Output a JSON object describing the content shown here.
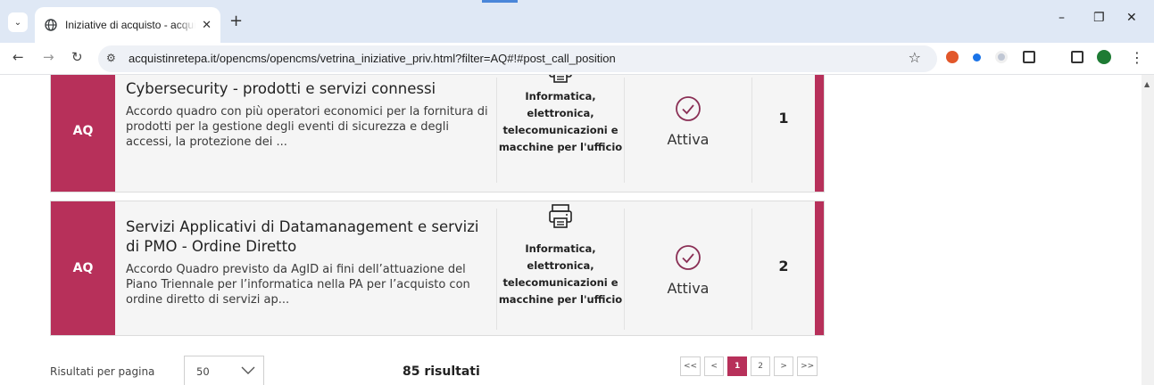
{
  "browser": {
    "tab_title": "Iniziative di acquisto - acquistin",
    "url": "acquistinretepa.it/opencms/opencms/vetrina_iniziative_priv.html?filter=AQ#!#post_call_position",
    "window_controls": {
      "minimize": "–",
      "restore": "❐",
      "close": "✕"
    },
    "tab_close": "✕",
    "new_tab": "+"
  },
  "cards": [
    {
      "badge": "AQ",
      "title": "Cybersecurity - prodotti e servizi connessi",
      "description": "Accordo quadro con più operatori economici per la fornitura di prodotti per la gestione degli eventi di sicurezza e degli accessi, la protezione dei ...",
      "category": "Informatica, elettronica, telecomunicazioni e macchine per l'ufficio",
      "status": "Attiva",
      "number": "1"
    },
    {
      "badge": "AQ",
      "title": "Servizi Applicativi di Datamanagement e servizi di PMO - Ordine Diretto",
      "description": "Accordo Quadro previsto da AgID ai fini dell’attuazione del Piano Triennale per l’informatica nella PA per l’acquisto con ordine diretto di servizi ap...",
      "category": "Informatica, elettronica, telecomunicazioni e macchine per l'ufficio",
      "status": "Attiva",
      "number": "2"
    }
  ],
  "footer": {
    "results_per_page_label": "Risultati per pagina",
    "results_per_page_value": "50",
    "results_count": "85 risultati",
    "pager": {
      "first": "<<",
      "prev": "<",
      "page1": "1",
      "page2": "2",
      "next": ">",
      "last": ">>"
    }
  },
  "colors": {
    "accent": "#b7305a",
    "card_bg": "#f5f5f5"
  },
  "icons": [
    "chevron-down-icon",
    "globe-icon",
    "back-icon",
    "forward-icon",
    "reload-icon",
    "site-info-icon",
    "star-icon",
    "printer-icon",
    "check-circle-icon",
    "profile-icon"
  ]
}
